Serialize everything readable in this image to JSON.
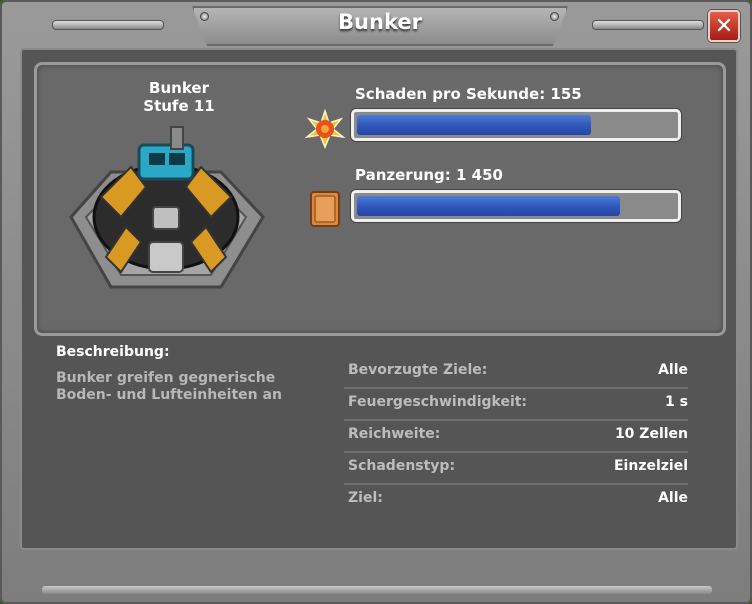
{
  "window": {
    "title": "Bunker",
    "close_label": "✕"
  },
  "building": {
    "name": "Bunker",
    "level": "Stufe 11"
  },
  "stats": [
    {
      "label": "Schaden pro Sekunde: 155",
      "icon": "explosion-icon",
      "fill_fraction": 0.74
    },
    {
      "label": "Panzerung: 1 450",
      "icon": "armor-plate-icon",
      "fill_fraction": 0.83
    }
  ],
  "description": {
    "heading": "Beschreibung:",
    "text": "Bunker greifen gegnerische Boden- und Lufteinheiten an"
  },
  "properties": [
    {
      "key": "Bevorzugte Ziele:",
      "value": "Alle"
    },
    {
      "key": "Feuergeschwindigkeit:",
      "value": "1 s"
    },
    {
      "key": "Reichweite:",
      "value": "10 Zellen"
    },
    {
      "key": "Schadenstyp:",
      "value": "Einzelziel"
    },
    {
      "key": "Ziel:",
      "value": "Alle"
    }
  ],
  "colors": {
    "bar_fill": "#2f56b8",
    "close_button": "#c0392b"
  }
}
